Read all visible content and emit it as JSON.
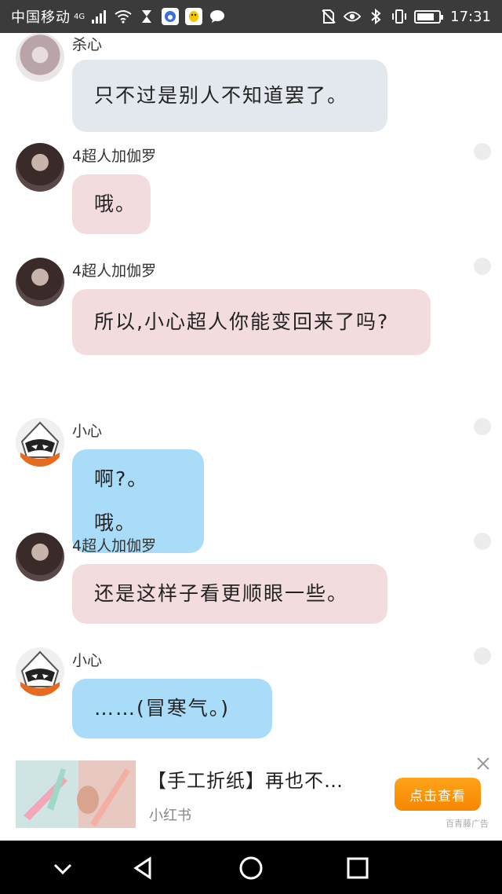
{
  "status_bar": {
    "carrier": "中国移动",
    "network": "4G",
    "time": "17:31"
  },
  "messages": [
    {
      "sender": "杀心",
      "text": "只不过是别人不知道罢了。",
      "avatar": "avatar-girl2",
      "style": "gray"
    },
    {
      "sender": "4超人加伽罗",
      "text": "哦。",
      "avatar": "avatar-girl",
      "style": "pink"
    },
    {
      "sender": "4超人加伽罗",
      "text": "所以,小心超人你能变回来了吗?",
      "avatar": "avatar-girl",
      "style": "pink"
    },
    {
      "sender": "小心",
      "text": "啊?。哦。",
      "avatar": "avatar-robot",
      "style": "blue"
    },
    {
      "sender": "4超人加伽罗",
      "text": "还是这样子看更顺眼一些。",
      "avatar": "avatar-girl",
      "style": "pink"
    },
    {
      "sender": "小心",
      "text": "……(冒寒气。)",
      "avatar": "avatar-robot",
      "style": "blue"
    }
  ],
  "ad": {
    "title": "【手工折纸】再也不…",
    "source": "小红书",
    "button_label": "点击查看",
    "close_icon": "close-icon",
    "tag": "百青藤广告"
  },
  "nav_bar": {
    "icons": [
      "chevron-down-icon",
      "back-triangle-icon",
      "home-circle-icon",
      "recents-square-icon"
    ]
  }
}
